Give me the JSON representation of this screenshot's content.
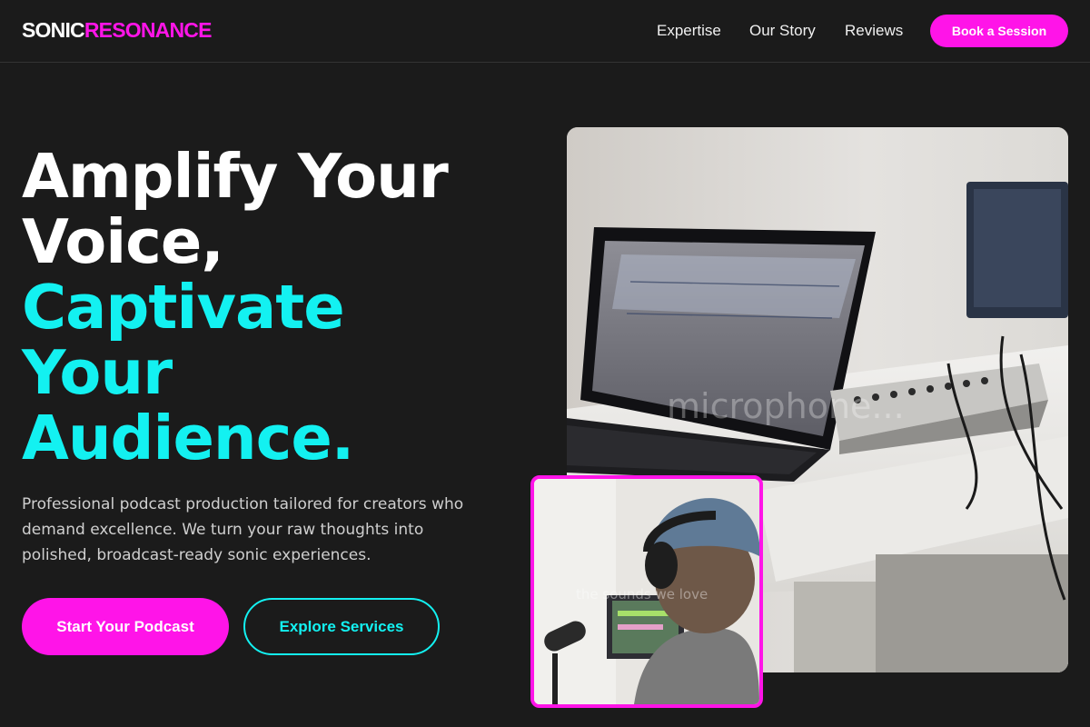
{
  "brand": {
    "part1": "SONIC",
    "part2": "RESONANCE"
  },
  "nav": {
    "items": [
      "Expertise",
      "Our Story",
      "Reviews"
    ],
    "cta": "Book a Session"
  },
  "hero": {
    "headline_white": [
      "Amplify Your",
      "Voice,"
    ],
    "headline_cyan": [
      "Captivate",
      "Your",
      "Audience."
    ],
    "subtext": "Professional podcast production tailored for creators who demand excellence. We turn your raw thoughts into polished, broadcast-ready sonic experiences.",
    "primary_button": "Start Your Podcast",
    "secondary_button": "Explore Services"
  },
  "images": {
    "main_caption": "microphone...",
    "inset_caption": "the sounds we love"
  },
  "colors": {
    "accent_pink": "#ff14e8",
    "accent_cyan": "#13f1f1",
    "background": "#1b1b1b"
  }
}
